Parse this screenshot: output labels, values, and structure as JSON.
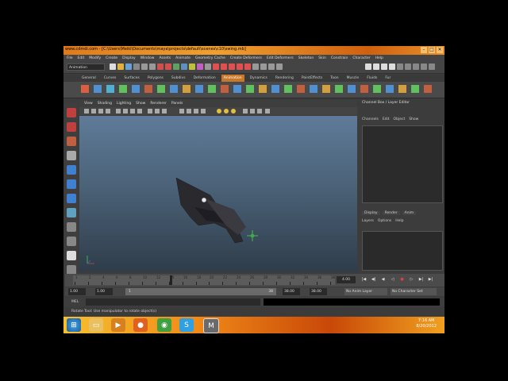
{
  "window": {
    "title": "www.cdmdi.com - [C:\\Users\\Meiki\\Documents\\maya\\projects\\default\\scenes\\c10\\swing.mb]",
    "buttons": [
      "–",
      "□",
      "✕"
    ]
  },
  "menubar": [
    "File",
    "Edit",
    "Modify",
    "Create",
    "Display",
    "Window",
    "Assets",
    "Animate",
    "Geometry Cache",
    "Create Deformers",
    "Edit Deformers",
    "Skeleton",
    "Skin",
    "Constrain",
    "Character",
    "Help"
  ],
  "mode_selector": "Animation",
  "shelf_tabs": [
    "General",
    "Curves",
    "Surfaces",
    "Polygons",
    "Subdivs",
    "Deformation",
    "Animation",
    "Dynamics",
    "Rendering",
    "PaintEffects",
    "Toon",
    "Muscle",
    "Fluids",
    "Fur"
  ],
  "shelf_active": "Animation",
  "viewport_menu": [
    "View",
    "Shading",
    "Lighting",
    "Show",
    "Renderer",
    "Panels"
  ],
  "channel_box": {
    "title": "Channel Box / Layer Editor",
    "tabs": [
      "Channels",
      "Edit",
      "Object",
      "Show"
    ]
  },
  "layer_editor": {
    "tabs": [
      "Display",
      "Render",
      "Anim"
    ],
    "menu": [
      "Layers",
      "Options",
      "Help"
    ]
  },
  "timeline": {
    "ticks": [
      "1",
      "2",
      "4",
      "6",
      "8",
      "10",
      "12",
      "14",
      "16",
      "18",
      "20",
      "22",
      "24",
      "26",
      "28",
      "30",
      "32",
      "34",
      "36",
      "38"
    ],
    "current_frame": "4.00",
    "playhead_fraction": 0.37
  },
  "range": {
    "start": "1.00",
    "playback_start": "1.00",
    "slider_start": "1",
    "slider_end": "38",
    "end": "38.00",
    "playback_end": "38.00",
    "anim_layer": "No Anim Layer",
    "character_set": "No Character Set"
  },
  "command_line": {
    "label": "MEL"
  },
  "help_line": "Rotate Tool: Use manipulator to rotate object(s)",
  "taskbar": {
    "clock_time": "7:16 AM",
    "clock_date": "8/20/2012"
  },
  "colors": {
    "accent": "#c87828",
    "viewport_top": "#5f7b99",
    "viewport_bottom": "#2f3d4a"
  }
}
